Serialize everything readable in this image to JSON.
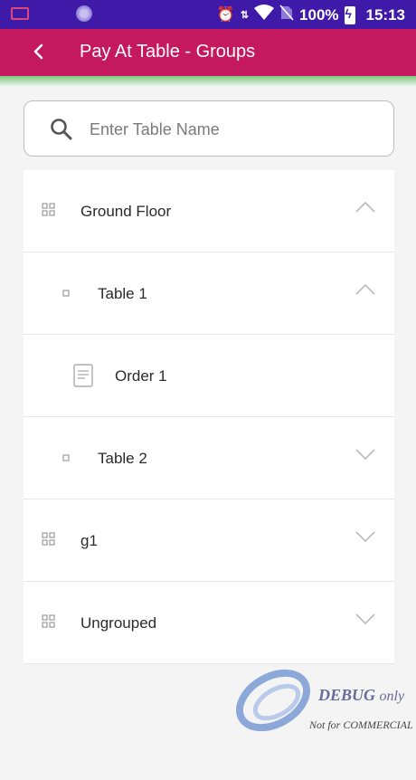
{
  "status_bar": {
    "battery": "100%",
    "time": "15:13",
    "icons": [
      "message-icon",
      "dots-icon",
      "alarm-icon",
      "data-arrows-icon",
      "wifi-icon",
      "no-sim-icon",
      "battery-charging-icon"
    ]
  },
  "app_bar": {
    "title": "Pay At Table - Groups",
    "back_icon": "chevron-left-icon"
  },
  "colors": {
    "status_bar": "#3f1aa8",
    "app_bar": "#c4185f",
    "accent": "#7bc87e"
  },
  "search": {
    "placeholder": "Enter Table Name",
    "value": ""
  },
  "tree": [
    {
      "label": "Ground Floor",
      "level": 0,
      "kind": "group",
      "expanded": true
    },
    {
      "label": "Table 1",
      "level": 1,
      "kind": "table",
      "expanded": true
    },
    {
      "label": "Order 1",
      "level": 2,
      "kind": "order"
    },
    {
      "label": "Table 2",
      "level": 1,
      "kind": "table",
      "expanded": false
    },
    {
      "label": "g1",
      "level": 0,
      "kind": "group",
      "expanded": false
    },
    {
      "label": "Ungrouped",
      "level": 0,
      "kind": "group",
      "expanded": false
    }
  ],
  "watermark": {
    "line1": "DEBUG",
    "line1_suffix": "only",
    "line2": "Not for COMMERCIAL"
  }
}
